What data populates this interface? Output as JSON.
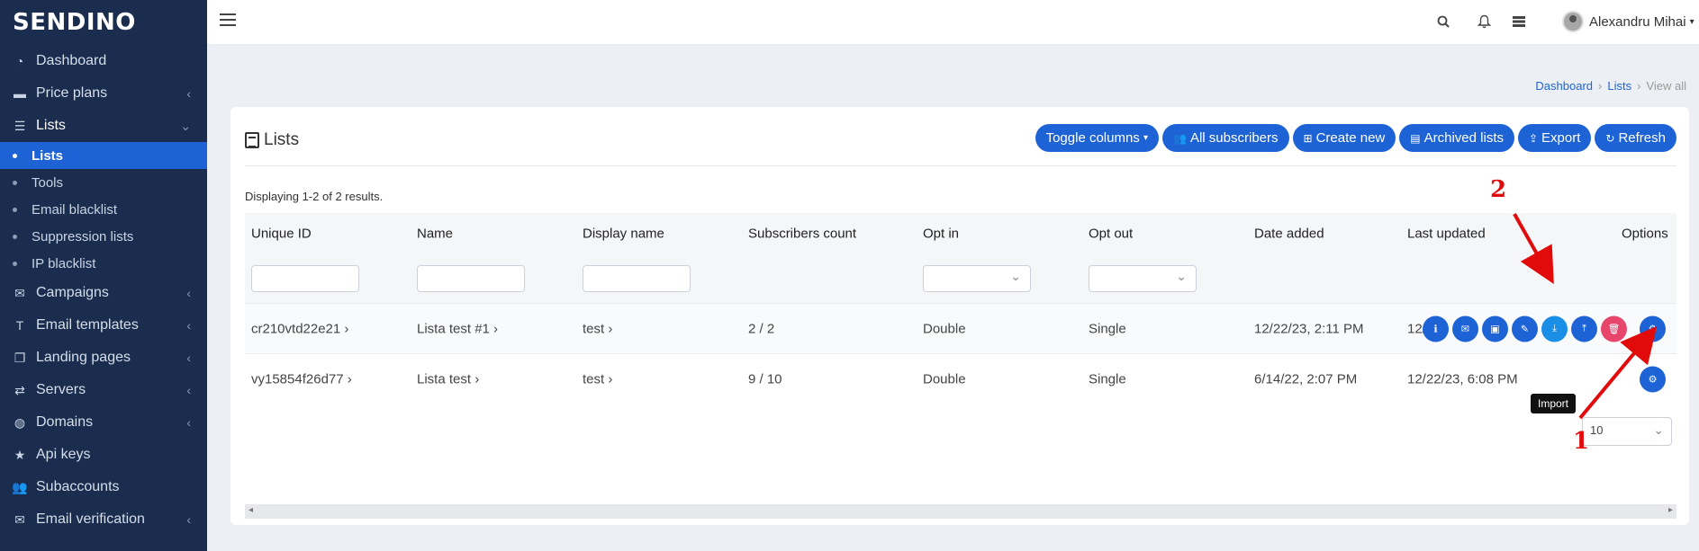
{
  "brand": {
    "logo_text": "SENDINO"
  },
  "sidebar": {
    "items": [
      {
        "label": "Dashboard",
        "icon": "gauge-icon",
        "caret": false
      },
      {
        "label": "Price plans",
        "icon": "credit-card-icon",
        "caret": true
      },
      {
        "label": "Lists",
        "icon": "list-icon",
        "caret": true,
        "open": true
      },
      {
        "label": "Campaigns",
        "icon": "envelope-icon",
        "caret": true
      },
      {
        "label": "Email templates",
        "icon": "text-icon",
        "caret": true
      },
      {
        "label": "Landing pages",
        "icon": "pages-icon",
        "caret": true
      },
      {
        "label": "Servers",
        "icon": "exchange-icon",
        "caret": true
      },
      {
        "label": "Domains",
        "icon": "globe-icon",
        "caret": true
      },
      {
        "label": "Api keys",
        "icon": "star-icon",
        "caret": false
      },
      {
        "label": "Subaccounts",
        "icon": "users-icon",
        "caret": false
      },
      {
        "label": "Email verification",
        "icon": "envelope-check-icon",
        "caret": true
      }
    ],
    "lists_sub": [
      "Lists",
      "Tools",
      "Email blacklist",
      "Suppression lists",
      "IP blacklist"
    ],
    "active_sub": "Lists"
  },
  "topbar": {
    "user_name": "Alexandru Mihai",
    "icons": [
      "menu-icon",
      "search-icon",
      "bell-icon",
      "server-icon"
    ]
  },
  "breadcrumb": {
    "items": [
      "Dashboard",
      "Lists"
    ],
    "current": "View all",
    "separator": "›"
  },
  "panel": {
    "title": "Lists",
    "buttons": [
      {
        "label": "Toggle columns",
        "icon": "",
        "caret": "▾"
      },
      {
        "label": "All subscribers",
        "icon": "users-icon"
      },
      {
        "label": "Create new",
        "icon": "plus-square-icon"
      },
      {
        "label": "Archived lists",
        "icon": "archive-icon"
      },
      {
        "label": "Export",
        "icon": "export-icon"
      },
      {
        "label": "Refresh",
        "icon": "refresh-icon"
      }
    ],
    "summary": "Displaying 1-2 of 2 results."
  },
  "table": {
    "columns": [
      "Unique ID",
      "Name",
      "Display name",
      "Subscribers count",
      "Opt in",
      "Opt out",
      "Date added",
      "Last updated",
      "Options"
    ],
    "rows": [
      {
        "unique_id": "cr210vtd22e21 ›",
        "name": "Lista test #1 ›",
        "display_name": "test ›",
        "subscribers": "2 / 2",
        "opt_in": "Double",
        "opt_out": "Single",
        "date_added": "12/22/23, 2:11 PM",
        "last_updated": "12/"
      },
      {
        "unique_id": "vy15854f26d77 ›",
        "name": "Lista test ›",
        "display_name": "test ›",
        "subscribers": "9 / 10",
        "opt_in": "Double",
        "opt_out": "Single",
        "date_added": "6/14/22, 2:07 PM",
        "last_updated": "12/22/23, 6:08 PM"
      }
    ],
    "option_icons": [
      "info-icon",
      "envelope-icon",
      "overview-icon",
      "edit-icon",
      "import-icon",
      "export-icon",
      "delete-icon"
    ],
    "tooltip": "Import",
    "page_size": "10"
  },
  "annotations": {
    "first": "1",
    "second": "2"
  },
  "colors": {
    "sidebar_bg": "#1a2d4f",
    "primary": "#1e63d6",
    "danger": "#e8456b",
    "annotation": "#e10b0b"
  }
}
